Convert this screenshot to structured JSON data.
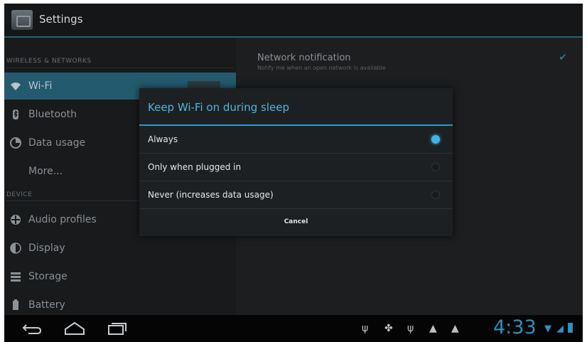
{
  "app": {
    "title": "Settings"
  },
  "sidebar": {
    "section_wireless": "WIRELESS & NETWORKS",
    "section_device": "DEVICE",
    "items": [
      {
        "label": "Wi-Fi",
        "icon": "wifi-icon"
      },
      {
        "label": "Bluetooth",
        "icon": "bluetooth-icon"
      },
      {
        "label": "Data usage",
        "icon": "data-usage-icon"
      },
      {
        "label": "More..."
      },
      {
        "label": "Audio profiles",
        "icon": "audio-profiles-icon"
      },
      {
        "label": "Display",
        "icon": "display-icon"
      },
      {
        "label": "Storage",
        "icon": "storage-icon"
      },
      {
        "label": "Battery",
        "icon": "battery-icon"
      }
    ]
  },
  "detail": {
    "notification_title": "Network notification",
    "notification_sub": "Notify me when an open network is available"
  },
  "dialog": {
    "title": "Keep Wi-Fi on during sleep",
    "options": [
      "Always",
      "Only when plugged in",
      "Never (increases data usage)"
    ],
    "selected_index": 0,
    "cancel_label": "Cancel"
  },
  "status_bar": {
    "time": "4:33"
  },
  "colors": {
    "accent": "#3fb4e5",
    "selected_row": "#245a6e"
  }
}
